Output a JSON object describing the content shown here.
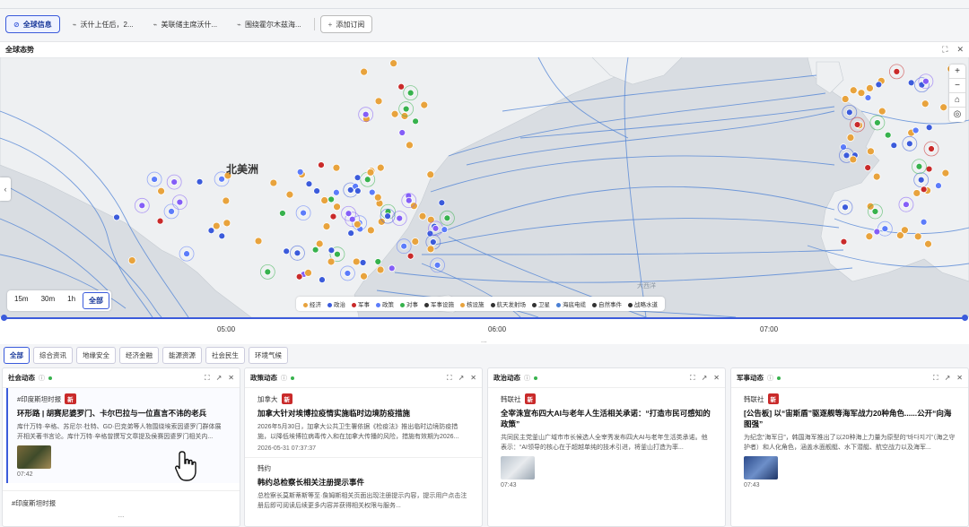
{
  "tabs": [
    {
      "label": "全球信息",
      "icon": "globe-off-icon",
      "active": true
    },
    {
      "label": "沃什上任后，2...",
      "icon": "chart-icon",
      "active": false
    },
    {
      "label": "美联储主席沃什...",
      "icon": "chart-icon",
      "active": false
    },
    {
      "label": "围绕霍尔木兹海...",
      "icon": "chart-icon",
      "active": false
    },
    {
      "label": "添加订阅",
      "icon": "plus-icon",
      "active": false
    }
  ],
  "panel": {
    "title": "全球态势"
  },
  "map": {
    "label_north_america": "北美洲",
    "label_ocean": "大西洋",
    "zoom_in": "+",
    "zoom_out": "−",
    "expand_icon": "‹"
  },
  "range_buttons": [
    "15m",
    "30m",
    "1h",
    "全部"
  ],
  "range_active": "全部",
  "legend": [
    {
      "label": "经济",
      "color": "#e8a33d"
    },
    {
      "label": "政治",
      "color": "#3b5bdb"
    },
    {
      "label": "军事",
      "color": "#c92a2a"
    },
    {
      "label": "政策",
      "color": "#5c7cfa"
    },
    {
      "label": "对事",
      "color": "#37b24d"
    },
    {
      "label": "军事设施",
      "color": "#333333"
    },
    {
      "label": "核设施",
      "color": "#e8a33d"
    },
    {
      "label": "航天发射场",
      "color": "#333333"
    },
    {
      "label": "卫星",
      "color": "#333333"
    },
    {
      "label": "海底电缆",
      "color": "#4a7fd4"
    },
    {
      "label": "自然事件",
      "color": "#333333"
    },
    {
      "label": "战略水道",
      "color": "#333333"
    }
  ],
  "timeline": {
    "ticks": [
      "05:00",
      "06:00",
      "07:00"
    ],
    "more": "..."
  },
  "categories": [
    "全部",
    "综合资讯",
    "地缘安全",
    "经济金融",
    "能源资源",
    "社会民生",
    "环境气候"
  ],
  "cards": [
    {
      "title": "社会动态",
      "items": [
        {
          "source": "#印度斯坦时报",
          "badge": "新",
          "headline": "环形路 | 胡赛尼婆罗门、卡尔巴拉与一位直言不讳的老兵",
          "summary": "库什万特·辛格、苏尼尔·杜特、GD·巴克弟等人物围绕埃索因婆罗门群体展开相关著书言论。库什万特·辛格曾撰写文章提及侯赛因婆罗门相关内...",
          "time": "07:42",
          "thumb": true
        }
      ],
      "next_source": "#印度斯坦时报"
    },
    {
      "title": "政策动态",
      "items": [
        {
          "source": "加拿大",
          "badge": "新",
          "headline": "加拿大针对埃博拉疫情实施临时边境防疫措施",
          "summary": "2026年5月30日，加拿大公共卫生署依据《检疫法》推出临时边境防疫措施，以降低埃博拉病毒传入和在加拿大传播的风险，措施有效期为2026...",
          "time": "2026-05-31 07:37:37",
          "thumb": false
        },
        {
          "source": "韩约",
          "badge": "",
          "headline": "韩约总检察长相关注册提示事件",
          "summary": "总检察长莫斯蒂斯等至·詹姆斯相关页面出现注册提示内容，提示用户点击注册后即可阅读后续更多内容并获得相关权限与服务...",
          "time": "",
          "thumb": false
        }
      ]
    },
    {
      "title": "政治动态",
      "items": [
        {
          "source": "韩联社",
          "badge": "新",
          "headline": "全宰洙宣布四大AI与老年人生活相关承诺：“打造市民可感知的政策”",
          "summary": "共同民主党釜山广域市市长候选人全宰秀发布四大AI与老年生活类承诺。他表示：“AI领导的核心在于超越单纯的技术引进，将釜山打造为率...",
          "time": "07:43",
          "thumb": true
        }
      ]
    },
    {
      "title": "军事动态",
      "items": [
        {
          "source": "韩联社",
          "badge": "新",
          "headline": "[公告板] 以“宙斯盾”驱逐舰等海军战力20种角色......公开“向海图强”",
          "summary": "为纪念“海军日”，韩国海军推出了以20种海上力量为原型的“바다지기”（海之守护者）和人化角色，涵盖水面舰艇、水下潜艇、航空战力以及海军...",
          "time": "07:43",
          "thumb": true
        }
      ]
    }
  ]
}
